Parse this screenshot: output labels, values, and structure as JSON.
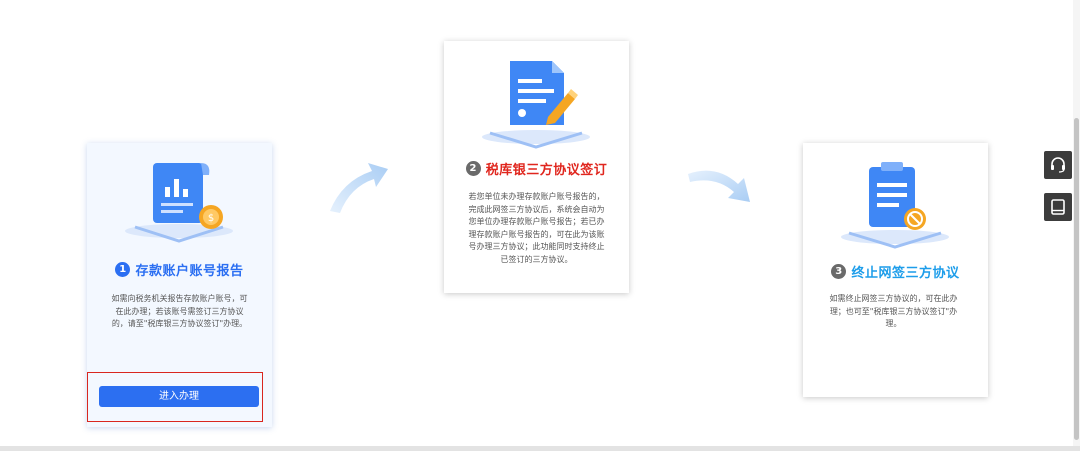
{
  "steps": [
    {
      "number": "1",
      "title": "存款账户账号报告",
      "desc_lines": [
        "如需向税务机关报告存款账户账号，可",
        "在此办理；若该账号需签订三方协议",
        "的，请至\"税库银三方协议签订\"办理。"
      ]
    },
    {
      "number": "2",
      "title": "税库银三方协议签订",
      "desc_lines": [
        "若您单位未办理存款账户账号报告的，",
        "完成此网签三方协议后，系统会自动为",
        "您单位办理存款账户账号报告；若已办",
        "理存款账户账号报告的，可在此为该账",
        "号办理三方协议；此功能同时支持终止",
        "已签订的三方协议。"
      ]
    },
    {
      "number": "3",
      "title": "终止网签三方协议",
      "desc_lines": [
        "如需终止网签三方协议的，可在此办",
        "理；也可至\"税库银三方协议签订\"办",
        "理。"
      ]
    }
  ],
  "enter_button_label": "进入办理",
  "side_tools": [
    "headset-icon",
    "manual-icon"
  ],
  "colors": {
    "primary": "#2b6ff2",
    "step2_title": "#e0261e",
    "step3_title": "#1d9dea",
    "highlight": "#d9271f"
  }
}
